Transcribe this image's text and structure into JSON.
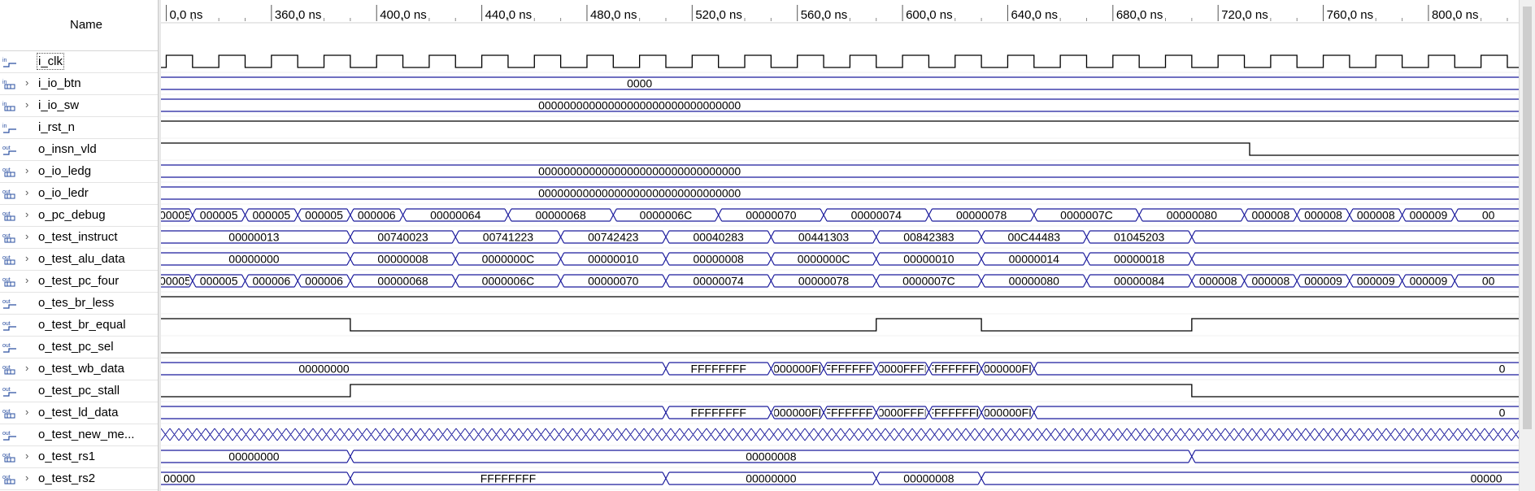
{
  "header": {
    "name_column_label": "Name"
  },
  "timeline": {
    "ticks": [
      {
        "t": 320,
        "label": "0,0 ns"
      },
      {
        "t": 360,
        "label": "360,0 ns"
      },
      {
        "t": 400,
        "label": "400,0 ns"
      },
      {
        "t": 440,
        "label": "440,0 ns"
      },
      {
        "t": 480,
        "label": "480,0 ns"
      },
      {
        "t": 520,
        "label": "520,0 ns"
      },
      {
        "t": 560,
        "label": "560,0 ns"
      },
      {
        "t": 600,
        "label": "600,0 ns"
      },
      {
        "t": 640,
        "label": "640,0 ns"
      },
      {
        "t": 680,
        "label": "680,0 ns"
      },
      {
        "t": 720,
        "label": "720,0 ns"
      },
      {
        "t": 760,
        "label": "760,0 ns"
      },
      {
        "t": 800,
        "label": "800,0 ns"
      }
    ],
    "view_start_ns": 318,
    "view_end_ns": 830,
    "clock_period_ns": 20,
    "clock_first_rise_ns": 320
  },
  "colors": {
    "bus": "#1a1a9c",
    "digital": "#000000",
    "undefined": "#1a1a9c",
    "text": "#000000"
  },
  "signals": [
    {
      "name": "i_clk",
      "icon": "input-bit-icon",
      "expandable": false,
      "kind": "clock",
      "selected": true
    },
    {
      "name": "i_io_btn",
      "icon": "input-bus-icon",
      "expandable": true,
      "kind": "bus",
      "segments": [
        {
          "start": 318,
          "end": 830,
          "value": "0000",
          "label_at": 500
        }
      ]
    },
    {
      "name": "i_io_sw",
      "icon": "input-bus-icon",
      "expandable": true,
      "kind": "bus",
      "segments": [
        {
          "start": 318,
          "end": 830,
          "value": "00000000000000000000000000000000",
          "label_at": 500
        }
      ]
    },
    {
      "name": "i_rst_n",
      "icon": "input-bit-icon",
      "expandable": false,
      "kind": "bit",
      "edges": [
        {
          "t": 318,
          "v": 1
        }
      ]
    },
    {
      "name": "o_insn_vld",
      "icon": "output-bit-icon",
      "expandable": false,
      "kind": "bit",
      "edges": [
        {
          "t": 318,
          "v": 1
        },
        {
          "t": 732,
          "v": 0
        }
      ]
    },
    {
      "name": "o_io_ledg",
      "icon": "output-bus-icon",
      "expandable": true,
      "kind": "bus",
      "segments": [
        {
          "start": 318,
          "end": 830,
          "value": "00000000000000000000000000000000",
          "label_at": 500
        }
      ]
    },
    {
      "name": "o_io_ledr",
      "icon": "output-bus-icon",
      "expandable": true,
      "kind": "bus",
      "segments": [
        {
          "start": 318,
          "end": 830,
          "value": "00000000000000000000000000000000",
          "label_at": 500
        }
      ]
    },
    {
      "name": "o_pc_debug",
      "icon": "output-bus-icon",
      "expandable": true,
      "kind": "bus",
      "segments": [
        {
          "start": 318,
          "end": 330,
          "value": "00005"
        },
        {
          "start": 330,
          "end": 350,
          "value": "000005"
        },
        {
          "start": 350,
          "end": 370,
          "value": "000005"
        },
        {
          "start": 370,
          "end": 390,
          "value": "000005"
        },
        {
          "start": 390,
          "end": 410,
          "value": "000006"
        },
        {
          "start": 410,
          "end": 450,
          "value": "00000064"
        },
        {
          "start": 450,
          "end": 490,
          "value": "00000068"
        },
        {
          "start": 490,
          "end": 530,
          "value": "0000006C"
        },
        {
          "start": 530,
          "end": 570,
          "value": "00000070"
        },
        {
          "start": 570,
          "end": 610,
          "value": "00000074"
        },
        {
          "start": 610,
          "end": 650,
          "value": "00000078"
        },
        {
          "start": 650,
          "end": 690,
          "value": "0000007C"
        },
        {
          "start": 690,
          "end": 730,
          "value": "00000080"
        },
        {
          "start": 730,
          "end": 750,
          "value": "000008"
        },
        {
          "start": 750,
          "end": 770,
          "value": "000008"
        },
        {
          "start": 770,
          "end": 790,
          "value": "000008"
        },
        {
          "start": 790,
          "end": 810,
          "value": "000009"
        },
        {
          "start": 810,
          "end": 830,
          "value": "00"
        }
      ]
    },
    {
      "name": "o_test_instruct",
      "icon": "output-bus-icon",
      "expandable": true,
      "kind": "bus",
      "segments": [
        {
          "start": 318,
          "end": 390,
          "value": "00000013"
        },
        {
          "start": 390,
          "end": 430,
          "value": "00740023"
        },
        {
          "start": 430,
          "end": 470,
          "value": "00741223"
        },
        {
          "start": 470,
          "end": 510,
          "value": "00742423"
        },
        {
          "start": 510,
          "end": 550,
          "value": "00040283"
        },
        {
          "start": 550,
          "end": 590,
          "value": "00441303"
        },
        {
          "start": 590,
          "end": 630,
          "value": "00842383"
        },
        {
          "start": 630,
          "end": 670,
          "value": "00C44483"
        },
        {
          "start": 670,
          "end": 710,
          "value": "01045203"
        },
        {
          "start": 710,
          "end": 830,
          "value": ""
        }
      ]
    },
    {
      "name": "o_test_alu_data",
      "icon": "output-bus-icon",
      "expandable": true,
      "kind": "bus",
      "segments": [
        {
          "start": 318,
          "end": 390,
          "value": "00000000"
        },
        {
          "start": 390,
          "end": 430,
          "value": "00000008"
        },
        {
          "start": 430,
          "end": 470,
          "value": "0000000C"
        },
        {
          "start": 470,
          "end": 510,
          "value": "00000010"
        },
        {
          "start": 510,
          "end": 550,
          "value": "00000008"
        },
        {
          "start": 550,
          "end": 590,
          "value": "0000000C"
        },
        {
          "start": 590,
          "end": 630,
          "value": "00000010"
        },
        {
          "start": 630,
          "end": 670,
          "value": "00000014"
        },
        {
          "start": 670,
          "end": 710,
          "value": "00000018"
        },
        {
          "start": 710,
          "end": 830,
          "value": ""
        }
      ]
    },
    {
      "name": "o_test_pc_four",
      "icon": "output-bus-icon",
      "expandable": true,
      "kind": "bus",
      "segments": [
        {
          "start": 318,
          "end": 330,
          "value": "00005"
        },
        {
          "start": 330,
          "end": 350,
          "value": "000005"
        },
        {
          "start": 350,
          "end": 370,
          "value": "000006"
        },
        {
          "start": 370,
          "end": 390,
          "value": "000006"
        },
        {
          "start": 390,
          "end": 430,
          "value": "00000068"
        },
        {
          "start": 430,
          "end": 470,
          "value": "0000006C"
        },
        {
          "start": 470,
          "end": 510,
          "value": "00000070"
        },
        {
          "start": 510,
          "end": 550,
          "value": "00000074"
        },
        {
          "start": 550,
          "end": 590,
          "value": "00000078"
        },
        {
          "start": 590,
          "end": 630,
          "value": "0000007C"
        },
        {
          "start": 630,
          "end": 670,
          "value": "00000080"
        },
        {
          "start": 670,
          "end": 710,
          "value": "00000084"
        },
        {
          "start": 710,
          "end": 730,
          "value": "000008"
        },
        {
          "start": 730,
          "end": 750,
          "value": "000008"
        },
        {
          "start": 750,
          "end": 770,
          "value": "000009"
        },
        {
          "start": 770,
          "end": 790,
          "value": "000009"
        },
        {
          "start": 790,
          "end": 810,
          "value": "000009"
        },
        {
          "start": 810,
          "end": 830,
          "value": "00"
        }
      ]
    },
    {
      "name": "o_tes_br_less",
      "icon": "output-bit-icon",
      "expandable": false,
      "kind": "bit",
      "edges": [
        {
          "t": 318,
          "v": 1
        }
      ]
    },
    {
      "name": "o_test_br_equal",
      "icon": "output-bit-icon",
      "expandable": false,
      "kind": "bit",
      "edges": [
        {
          "t": 318,
          "v": 1
        },
        {
          "t": 390,
          "v": 0
        },
        {
          "t": 590,
          "v": 1
        },
        {
          "t": 630,
          "v": 0
        },
        {
          "t": 710,
          "v": 1
        }
      ]
    },
    {
      "name": "o_test_pc_sel",
      "icon": "output-bit-icon",
      "expandable": false,
      "kind": "bit",
      "edges": [
        {
          "t": 318,
          "v": 0
        }
      ]
    },
    {
      "name": "o_test_wb_data",
      "icon": "output-bus-icon",
      "expandable": true,
      "kind": "bus",
      "segments": [
        {
          "start": 318,
          "end": 510,
          "value": "00000000",
          "label_at": 380
        },
        {
          "start": 510,
          "end": 550,
          "value": "FFFFFFFF"
        },
        {
          "start": 550,
          "end": 570,
          "value": "000000FI"
        },
        {
          "start": 570,
          "end": 590,
          "value": "FFFFFFFI"
        },
        {
          "start": 590,
          "end": 610,
          "value": "0000FFFI"
        },
        {
          "start": 610,
          "end": 630,
          "value": "FFFFFFFF"
        },
        {
          "start": 630,
          "end": 650,
          "value": "000000FI"
        },
        {
          "start": 650,
          "end": 830,
          "value": "0",
          "label_at": 828
        }
      ]
    },
    {
      "name": "o_test_pc_stall",
      "icon": "output-bit-icon",
      "expandable": false,
      "kind": "bit",
      "edges": [
        {
          "t": 318,
          "v": 0
        },
        {
          "t": 390,
          "v": 1
        },
        {
          "t": 710,
          "v": 0
        }
      ]
    },
    {
      "name": "o_test_ld_data",
      "icon": "output-bus-icon",
      "expandable": true,
      "kind": "bus",
      "segments": [
        {
          "start": 318,
          "end": 510,
          "value": ""
        },
        {
          "start": 510,
          "end": 550,
          "value": "FFFFFFFF"
        },
        {
          "start": 550,
          "end": 570,
          "value": "000000FI"
        },
        {
          "start": 570,
          "end": 590,
          "value": "FFFFFFFI"
        },
        {
          "start": 590,
          "end": 610,
          "value": "0000FFFI"
        },
        {
          "start": 610,
          "end": 630,
          "value": "FFFFFFFF"
        },
        {
          "start": 630,
          "end": 650,
          "value": "000000FI"
        },
        {
          "start": 650,
          "end": 830,
          "value": "0",
          "label_at": 828
        }
      ]
    },
    {
      "name": "o_test_new_me...",
      "icon": "output-bit-icon",
      "expandable": false,
      "kind": "undefined"
    },
    {
      "name": "o_test_rs1",
      "icon": "output-bus-icon",
      "expandable": true,
      "kind": "bus",
      "segments": [
        {
          "start": 318,
          "end": 390,
          "value": "00000000"
        },
        {
          "start": 390,
          "end": 710,
          "value": "00000008",
          "label_at": 550
        },
        {
          "start": 710,
          "end": 830,
          "value": ""
        }
      ]
    },
    {
      "name": "o_test_rs2",
      "icon": "output-bus-icon",
      "expandable": true,
      "kind": "bus",
      "segments": [
        {
          "start": 318,
          "end": 390,
          "value": "00000",
          "label_at": 325
        },
        {
          "start": 390,
          "end": 510,
          "value": "FFFFFFFF"
        },
        {
          "start": 510,
          "end": 590,
          "value": "00000000"
        },
        {
          "start": 590,
          "end": 630,
          "value": "00000008"
        },
        {
          "start": 630,
          "end": 830,
          "value": "00000",
          "label_at": 822
        }
      ]
    }
  ]
}
